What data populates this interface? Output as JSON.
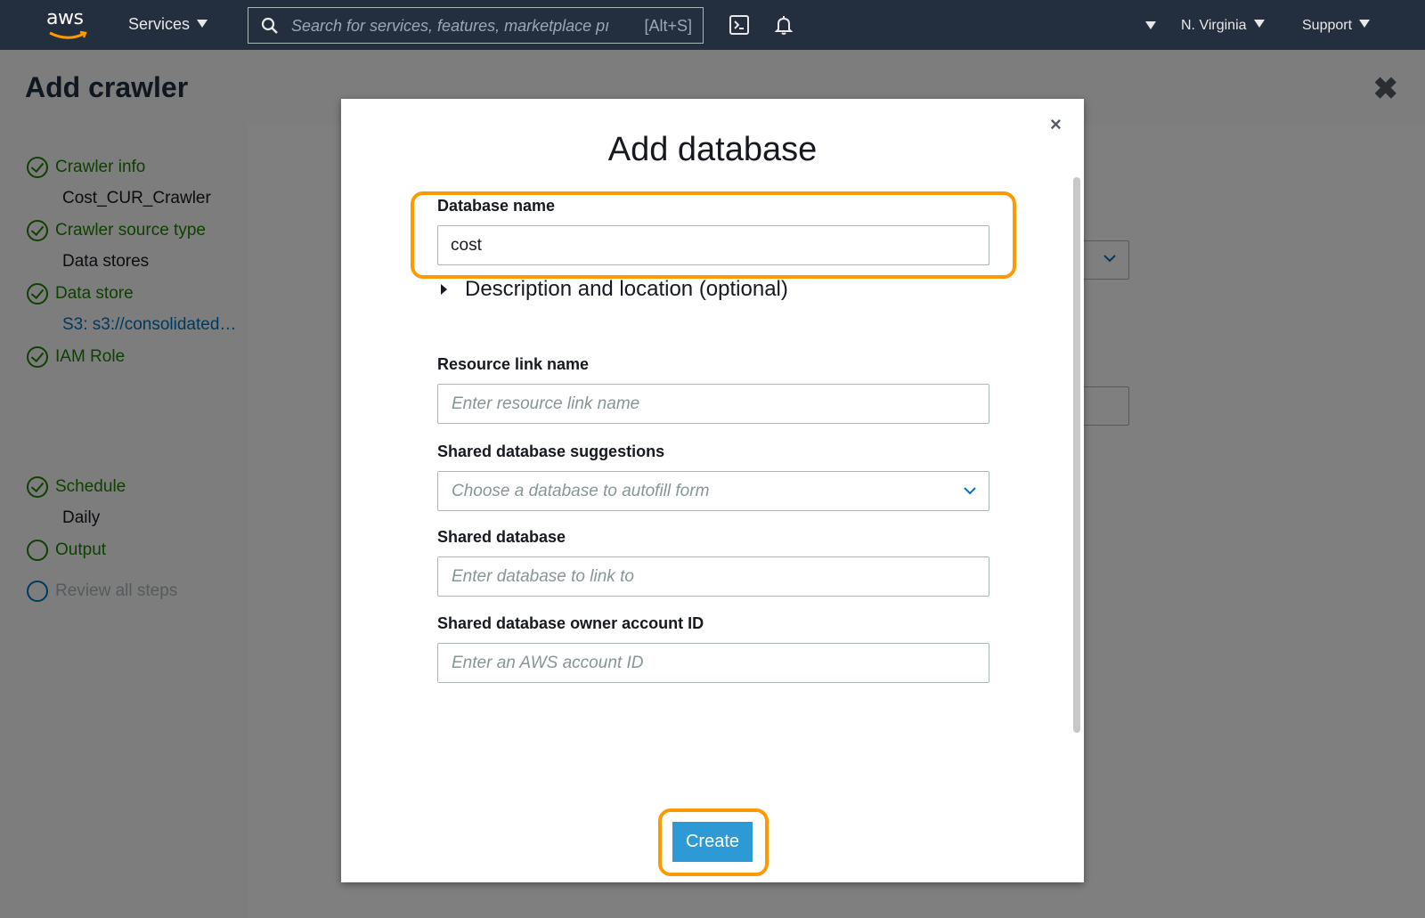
{
  "topnav": {
    "logo_text": "aws",
    "services_label": "Services",
    "search_placeholder": "Search for services, features, marketplace pı",
    "search_shortcut": "[Alt+S]",
    "region_label": "N. Virginia",
    "support_label": "Support"
  },
  "page": {
    "title": "Add crawler",
    "close_glyph": "✖"
  },
  "steps": [
    {
      "label": "Crawler info",
      "value": "Cost_CUR_Crawler",
      "state": "complete"
    },
    {
      "label": "Crawler source type",
      "value": "Data stores",
      "state": "complete"
    },
    {
      "label": "Data store",
      "value": "S3: s3://consolidated-cur",
      "state": "complete"
    },
    {
      "label": "IAM Role",
      "value": "",
      "state": "complete"
    },
    {
      "label": "Schedule",
      "value": "Daily",
      "state": "complete"
    },
    {
      "label": "Output",
      "value": "",
      "state": "current"
    },
    {
      "label": "Review all steps",
      "value": "",
      "state": "pending"
    }
  ],
  "modal": {
    "close_glyph": "×",
    "title": "Add database",
    "database_name": {
      "label": "Database name",
      "value": "cost"
    },
    "description_toggle": "Description and location (optional)",
    "resource_link": {
      "label": "Resource link name",
      "placeholder": "Enter resource link name"
    },
    "shared_suggestions": {
      "label": "Shared database suggestions",
      "placeholder": "Choose a database to autofill form"
    },
    "shared_database": {
      "label": "Shared database",
      "placeholder": "Enter database to link to"
    },
    "owner_account": {
      "label": "Shared database owner account ID",
      "placeholder": "Enter an AWS account ID"
    },
    "create_label": "Create"
  },
  "colors": {
    "nav_bg": "#232f3e",
    "highlight": "#ff9900",
    "success_green": "#1d8102",
    "primary_button": "#2d9ad6",
    "link_blue": "#0073bb"
  }
}
